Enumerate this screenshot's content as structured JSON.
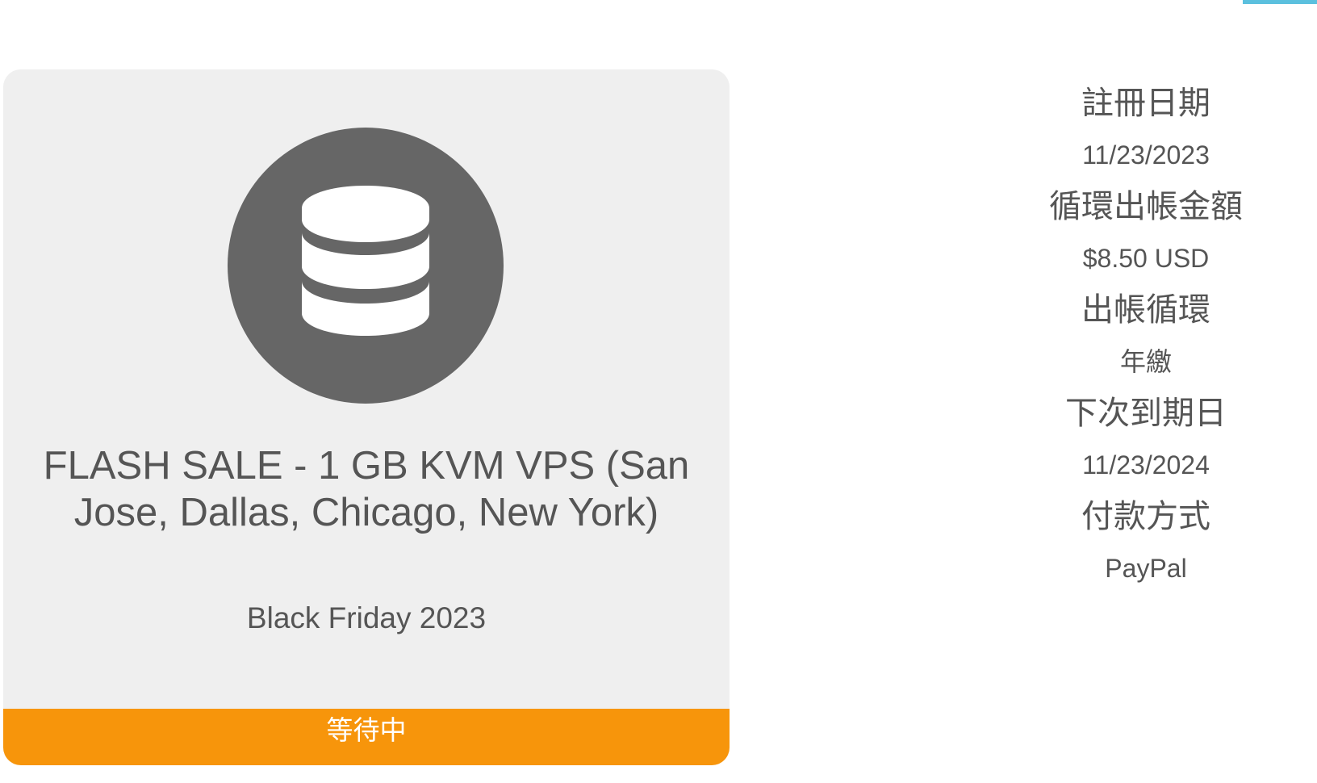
{
  "product": {
    "icon": "database-icon",
    "name": "FLASH SALE - 1 GB KVM VPS (San Jose, Dallas, Chicago, New York)",
    "group": "Black Friday 2023",
    "status": "等待中",
    "status_color": "#f7950b"
  },
  "details": {
    "registration_date_label": "註冊日期",
    "registration_date": "11/23/2023",
    "recurring_amount_label": "循環出帳金額",
    "recurring_amount": "$8.50 USD",
    "billing_cycle_label": "出帳循環",
    "billing_cycle": "年繳",
    "next_due_date_label": "下次到期日",
    "next_due_date": "11/23/2024",
    "payment_method_label": "付款方式",
    "payment_method": "PayPal"
  },
  "colors": {
    "accent": "#5bc0de",
    "icon_background": "#666666",
    "card_background": "#efefef",
    "text": "#555555"
  }
}
